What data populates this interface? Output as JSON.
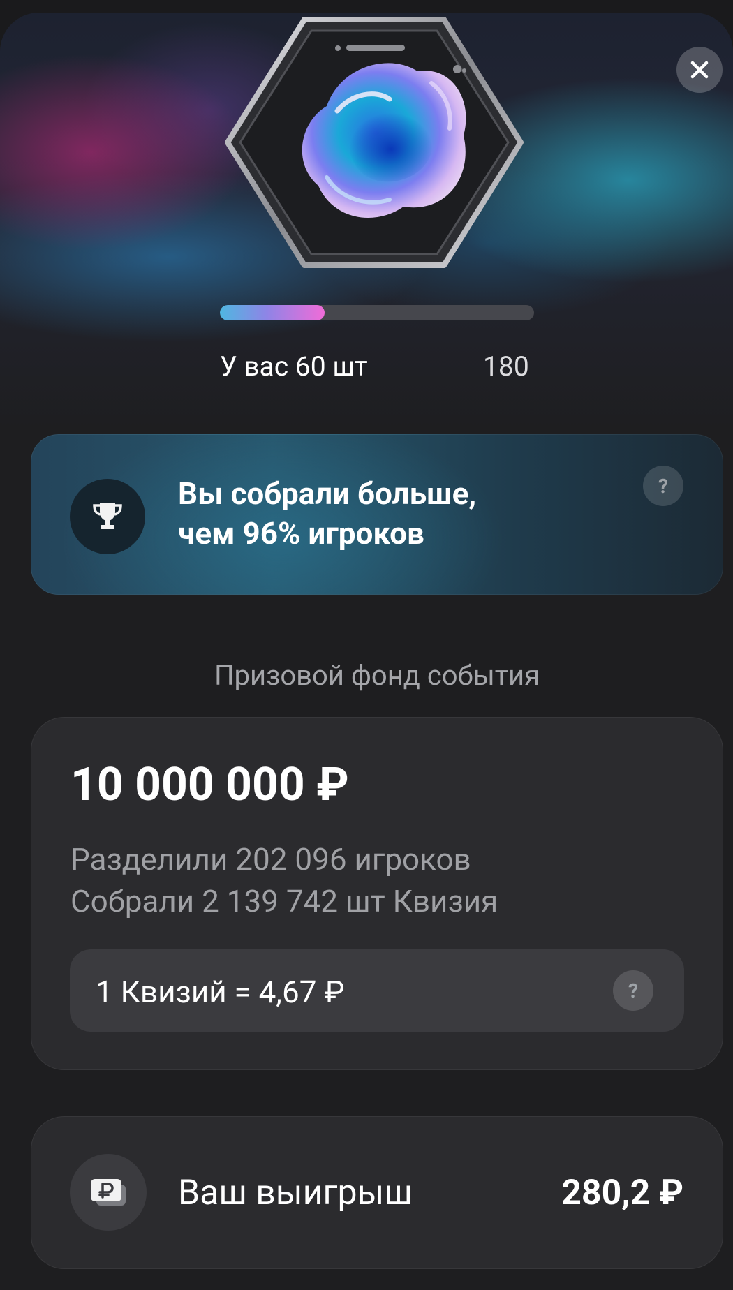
{
  "progress": {
    "collected_label": "У вас 60 шт",
    "goal": "180",
    "fraction": 0.333
  },
  "rank_card": {
    "line1": "Вы собрали больше,",
    "line2": "чем 96% игроков",
    "help": "?"
  },
  "prize_fund": {
    "title": "Призовой фонд события",
    "amount": "10 000 000 ₽",
    "players_line": "Разделили 202 096 игроков",
    "collected_line": "Собрали 2 139 742 шт Квизия",
    "rate": "1 Квизий = 4,67 ₽",
    "help": "?"
  },
  "winnings": {
    "label": "Ваш выигрыш",
    "amount": "280,2 ₽"
  },
  "colors": {
    "progress_start": "#4fb7e0",
    "progress_end": "#f06cd8",
    "card_bg": "#2b2b2e",
    "rank_card_accent": "#27566c"
  },
  "icons": {
    "close": "close-icon",
    "hero": "crystal-blob-icon",
    "trophy": "trophy-icon",
    "help": "question-icon",
    "winnings": "ruble-wallet-icon"
  }
}
